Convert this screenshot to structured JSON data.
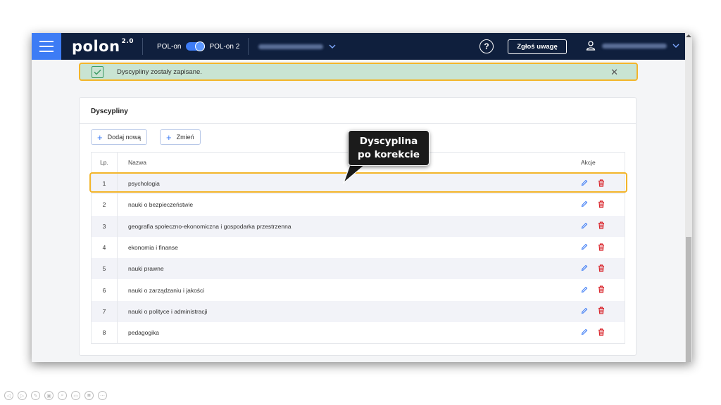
{
  "header": {
    "logo": "polon",
    "logo_version": "2.0",
    "toggle_left": "POL-on",
    "toggle_right": "POL-on 2",
    "help_symbol": "?",
    "report_label": "Zgłoś uwagę"
  },
  "alert": {
    "message": "Dyscypliny zostały zapisane.",
    "close_symbol": "✕"
  },
  "card": {
    "title": "Dyscypliny",
    "add_label": "Dodaj nową",
    "change_label": "Zmień"
  },
  "table": {
    "headers": {
      "lp": "Lp.",
      "name": "Nazwa",
      "actions": "Akcje"
    },
    "rows": [
      {
        "lp": "1",
        "name": "psychologia"
      },
      {
        "lp": "2",
        "name": "nauki o bezpieczeństwie"
      },
      {
        "lp": "3",
        "name": "geografia społeczno-ekonomiczna i gospodarka przestrzenna"
      },
      {
        "lp": "4",
        "name": "ekonomia i finanse"
      },
      {
        "lp": "5",
        "name": "nauki prawne"
      },
      {
        "lp": "6",
        "name": "nauki o zarządzaniu i jakości"
      },
      {
        "lp": "7",
        "name": "nauki o polityce i administracji"
      },
      {
        "lp": "8",
        "name": "pedagogika"
      }
    ]
  },
  "callout": {
    "line1": "Dyscyplina",
    "line2": "po korekcie"
  },
  "icons": {
    "menu": "hamburger-icon",
    "user": "user-icon",
    "edit": "pencil-icon",
    "delete": "trash-icon",
    "check": "check-icon"
  },
  "colors": {
    "topbar": "#0f1f3d",
    "accent": "#3d7cf5",
    "success_bg": "#c9e4d3",
    "highlight": "#f3b52a",
    "delete": "#d9252c"
  }
}
